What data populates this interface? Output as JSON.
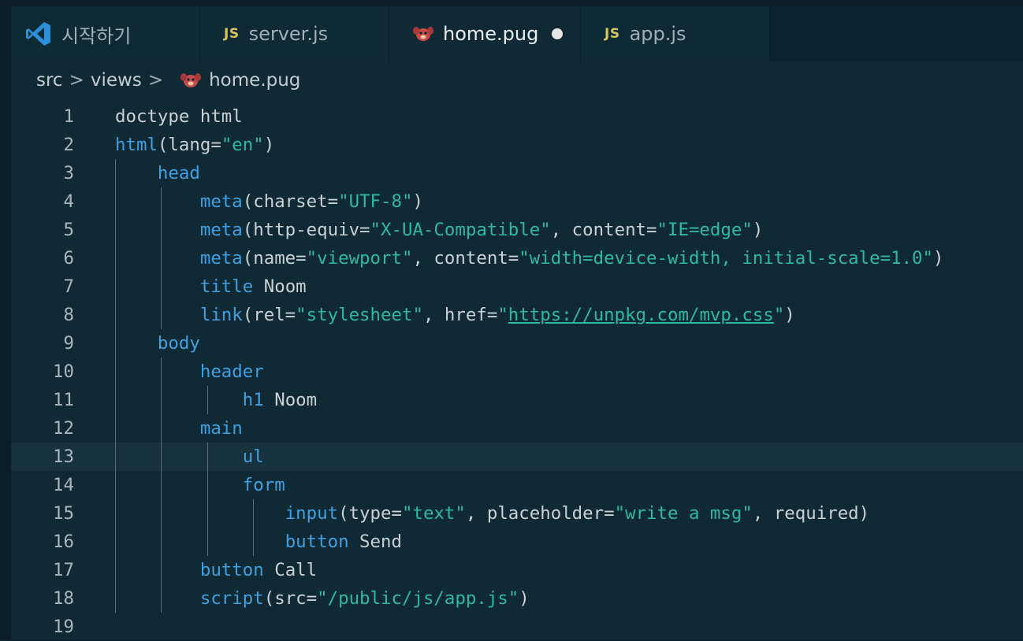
{
  "tabs": [
    {
      "label": "시작하기",
      "icon": "vscode-logo-icon",
      "active": false
    },
    {
      "label": "server.js",
      "icon": "js-file-icon",
      "icon_text": "JS",
      "active": false
    },
    {
      "label": "home.pug",
      "icon": "pug-file-icon",
      "active": true,
      "dirty": true
    },
    {
      "label": "app.js",
      "icon": "js-file-icon",
      "icon_text": "JS",
      "active": false
    }
  ],
  "breadcrumb": {
    "items": [
      "src",
      "views",
      "home.pug"
    ],
    "separator": ">"
  },
  "editor": {
    "current_line": 13,
    "lines": [
      {
        "n": "1",
        "tokens": [
          [
            "plain",
            "doctype html"
          ]
        ]
      },
      {
        "n": "2",
        "tokens": [
          [
            "tag",
            "html"
          ],
          [
            "plain",
            "(lang="
          ],
          [
            "str",
            "\"en\""
          ],
          [
            "plain",
            ")"
          ]
        ]
      },
      {
        "n": "3",
        "tokens": [
          [
            "plain",
            "    "
          ],
          [
            "tag",
            "head"
          ]
        ]
      },
      {
        "n": "4",
        "tokens": [
          [
            "plain",
            "        "
          ],
          [
            "tag",
            "meta"
          ],
          [
            "plain",
            "(charset="
          ],
          [
            "str",
            "\"UTF-8\""
          ],
          [
            "plain",
            ")"
          ]
        ]
      },
      {
        "n": "5",
        "tokens": [
          [
            "plain",
            "        "
          ],
          [
            "tag",
            "meta"
          ],
          [
            "plain",
            "(http-equiv="
          ],
          [
            "str",
            "\"X-UA-Compatible\""
          ],
          [
            "plain",
            ", content="
          ],
          [
            "str",
            "\"IE=edge\""
          ],
          [
            "plain",
            ")"
          ]
        ]
      },
      {
        "n": "6",
        "tokens": [
          [
            "plain",
            "        "
          ],
          [
            "tag",
            "meta"
          ],
          [
            "plain",
            "(name="
          ],
          [
            "str",
            "\"viewport\""
          ],
          [
            "plain",
            ", content="
          ],
          [
            "str",
            "\"width=device-width, initial-scale=1.0\""
          ],
          [
            "plain",
            ")"
          ]
        ]
      },
      {
        "n": "7",
        "tokens": [
          [
            "plain",
            "        "
          ],
          [
            "tag",
            "title"
          ],
          [
            "plain",
            " Noom"
          ]
        ]
      },
      {
        "n": "8",
        "tokens": [
          [
            "plain",
            "        "
          ],
          [
            "tag",
            "link"
          ],
          [
            "plain",
            "(rel="
          ],
          [
            "str",
            "\"stylesheet\""
          ],
          [
            "plain",
            ", href="
          ],
          [
            "str",
            "\""
          ],
          [
            "str link",
            "https://unpkg.com/mvp.css"
          ],
          [
            "str",
            "\""
          ],
          [
            "plain",
            ")"
          ]
        ]
      },
      {
        "n": "9",
        "tokens": [
          [
            "plain",
            "    "
          ],
          [
            "tag",
            "body"
          ]
        ]
      },
      {
        "n": "10",
        "tokens": [
          [
            "plain",
            "        "
          ],
          [
            "tag",
            "header"
          ]
        ]
      },
      {
        "n": "11",
        "tokens": [
          [
            "plain",
            "            "
          ],
          [
            "tag",
            "h1"
          ],
          [
            "plain",
            " Noom"
          ]
        ]
      },
      {
        "n": "12",
        "tokens": [
          [
            "plain",
            "        "
          ],
          [
            "tag",
            "main"
          ]
        ]
      },
      {
        "n": "13",
        "tokens": [
          [
            "plain",
            "            "
          ],
          [
            "tag",
            "ul"
          ]
        ]
      },
      {
        "n": "14",
        "tokens": [
          [
            "plain",
            "            "
          ],
          [
            "tag",
            "form"
          ]
        ]
      },
      {
        "n": "15",
        "tokens": [
          [
            "plain",
            "                "
          ],
          [
            "tag",
            "input"
          ],
          [
            "plain",
            "(type="
          ],
          [
            "str",
            "\"text\""
          ],
          [
            "plain",
            ", placeholder="
          ],
          [
            "str",
            "\"write a msg\""
          ],
          [
            "plain",
            ", required)"
          ]
        ]
      },
      {
        "n": "16",
        "tokens": [
          [
            "plain",
            "                "
          ],
          [
            "tag",
            "button"
          ],
          [
            "plain",
            " Send"
          ]
        ]
      },
      {
        "n": "17",
        "tokens": [
          [
            "plain",
            "        "
          ],
          [
            "tag",
            "button"
          ],
          [
            "plain",
            " Call"
          ]
        ]
      },
      {
        "n": "18",
        "tokens": [
          [
            "plain",
            "        "
          ],
          [
            "tag",
            "script"
          ],
          [
            "plain",
            "(src="
          ],
          [
            "str",
            "\"/public/js/app.js\""
          ],
          [
            "plain",
            ")"
          ]
        ]
      },
      {
        "n": "19",
        "tokens": []
      }
    ]
  },
  "colors": {
    "tag": "#3f9fe0",
    "string": "#2eb8a4",
    "plain": "#c9d1d5",
    "line_number": "#a9b6bc",
    "background": "#0f2a35",
    "current_line_bg": "#16323e",
    "js_icon": "#d8c45a",
    "pug_icon": "#c94a4a"
  }
}
